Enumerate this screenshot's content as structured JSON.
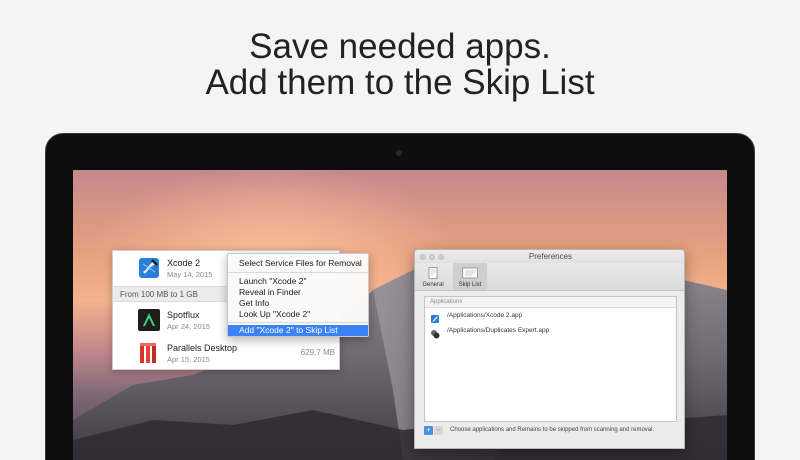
{
  "headline": {
    "line1": "Save needed apps.",
    "line2": "Add them to the Skip List"
  },
  "app_list": {
    "apps": [
      {
        "name": "Xcode 2",
        "date": "May 14, 2015",
        "size": "",
        "icon": "xcode-icon"
      },
      {
        "name": "Spotflux",
        "date": "Apr 24, 2015",
        "size": "",
        "icon": "spotflux-icon"
      },
      {
        "name": "Parallels Desktop",
        "date": "Apr 15, 2015",
        "size": "629,7 MB",
        "icon": "parallels-icon"
      }
    ],
    "group_header": "From 100 MB to 1 GB"
  },
  "context_menu": {
    "items": [
      "Select Service Files for Removal",
      "Launch \"Xcode 2\"",
      "Reveal in Finder",
      "Get Info",
      "Look Up \"Xcode 2\"",
      "Add \"Xcode 2\" to Skip List"
    ],
    "highlighted": "Add \"Xcode 2\" to Skip List"
  },
  "preferences": {
    "title": "Preferences",
    "tabs": [
      {
        "label": "General",
        "icon": "general-icon"
      },
      {
        "label": "Skip List",
        "icon": "skip-list-icon",
        "active": true
      }
    ],
    "list_header": "Applications",
    "rows": [
      {
        "path": "/Applications/Xcode 2.app",
        "icon": "xcode-icon"
      },
      {
        "path": "/Applications/Duplicates Expert.app",
        "icon": "duplicates-expert-icon"
      }
    ],
    "add_label": "+",
    "remove_label": "−",
    "hint": "Choose applications and Remains to be skipped from scanning and removal."
  },
  "colors": {
    "accent": "#3a82f6",
    "headline": "#222222"
  }
}
